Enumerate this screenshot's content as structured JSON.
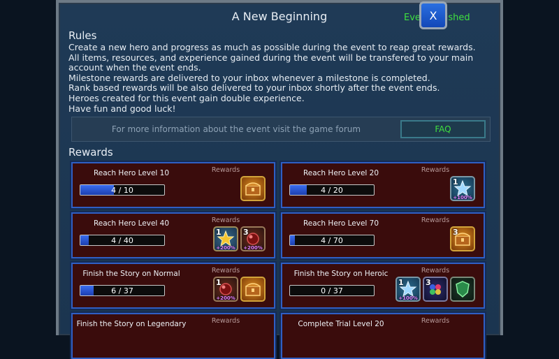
{
  "header": {
    "title": "A New Beginning",
    "status": "Event Finished",
    "close_label": "X"
  },
  "rules": {
    "heading": "Rules",
    "lines": [
      "Create a new hero and progress as much as possible during the event to reap great rewards.",
      "All items, resources, and experience gained during the event will be transfered to your main account when the event ends.",
      "Milestone rewards are delivered to your inbox whenever a milestone is completed.",
      "Rank based rewards will be also delivered to your inbox shortly after the event ends.",
      "Heroes created for this event gain double experience.",
      "Have fun and good luck!"
    ]
  },
  "info": {
    "text": "For more information about the event visit the game forum",
    "faq_label": "FAQ"
  },
  "rewards": {
    "heading": "Rewards",
    "rewards_label": "Rewards",
    "cards": [
      {
        "name": "Reach Hero Level 10",
        "progress": "4 / 10",
        "fraction": 0.4,
        "items": [
          {
            "icon": "chest-icon",
            "count": "",
            "pct": ""
          }
        ]
      },
      {
        "name": "Reach Hero Level 20",
        "progress": "4 / 20",
        "fraction": 0.2,
        "items": [
          {
            "icon": "star-icon",
            "count": "1",
            "pct": "+100%"
          }
        ]
      },
      {
        "name": "Reach Hero Level 40",
        "progress": "4 / 40",
        "fraction": 0.1,
        "items": [
          {
            "icon": "gold-star-icon",
            "count": "1",
            "pct": "+200%"
          },
          {
            "icon": "orb-icon",
            "count": "3",
            "pct": "+200%"
          }
        ]
      },
      {
        "name": "Reach Hero Level 70",
        "progress": "4 / 70",
        "fraction": 0.057,
        "items": [
          {
            "icon": "chest-icon",
            "count": "3",
            "pct": ""
          }
        ]
      },
      {
        "name": "Finish the Story on Normal",
        "progress": "6 / 37",
        "fraction": 0.162,
        "items": [
          {
            "icon": "orb-icon",
            "count": "1",
            "pct": "+200%"
          },
          {
            "icon": "chest-icon",
            "count": "",
            "pct": ""
          }
        ]
      },
      {
        "name": "Finish the Story on Heroic",
        "progress": "0 / 37",
        "fraction": 0,
        "items": [
          {
            "icon": "star-icon",
            "count": "1",
            "pct": "+100%"
          },
          {
            "icon": "gem-icon",
            "count": "3",
            "pct": ""
          },
          {
            "icon": "shield-icon",
            "count": "",
            "pct": ""
          }
        ]
      },
      {
        "name": "Finish the Story on Legendary",
        "progress": "",
        "fraction": 0,
        "items": []
      },
      {
        "name": "Complete Trial Level 20",
        "progress": "",
        "fraction": 0,
        "items": []
      }
    ]
  },
  "colors": {
    "accent_green": "#3fe03f",
    "card_border": "#2f5fc4",
    "bar_fill": "#2f5fe0"
  }
}
